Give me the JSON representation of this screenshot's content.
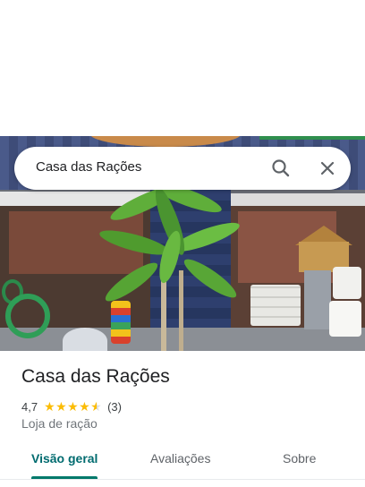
{
  "search": {
    "query": "Casa das Rações"
  },
  "place": {
    "name": "Casa das Rações",
    "rating": "4,7",
    "stars": 4.7,
    "review_count": "(3)",
    "category": "Loja de ração"
  },
  "tabs": [
    {
      "label": "Visão geral",
      "selected": true
    },
    {
      "label": "Avaliações",
      "selected": false
    },
    {
      "label": "Sobre",
      "selected": false
    }
  ],
  "icons": {
    "search": "search-icon",
    "close": "close-icon",
    "star": "star-icon"
  },
  "colors": {
    "accent": "#00796b",
    "star": "#fbbc04",
    "text": "#202124",
    "secondary": "#70757a"
  }
}
